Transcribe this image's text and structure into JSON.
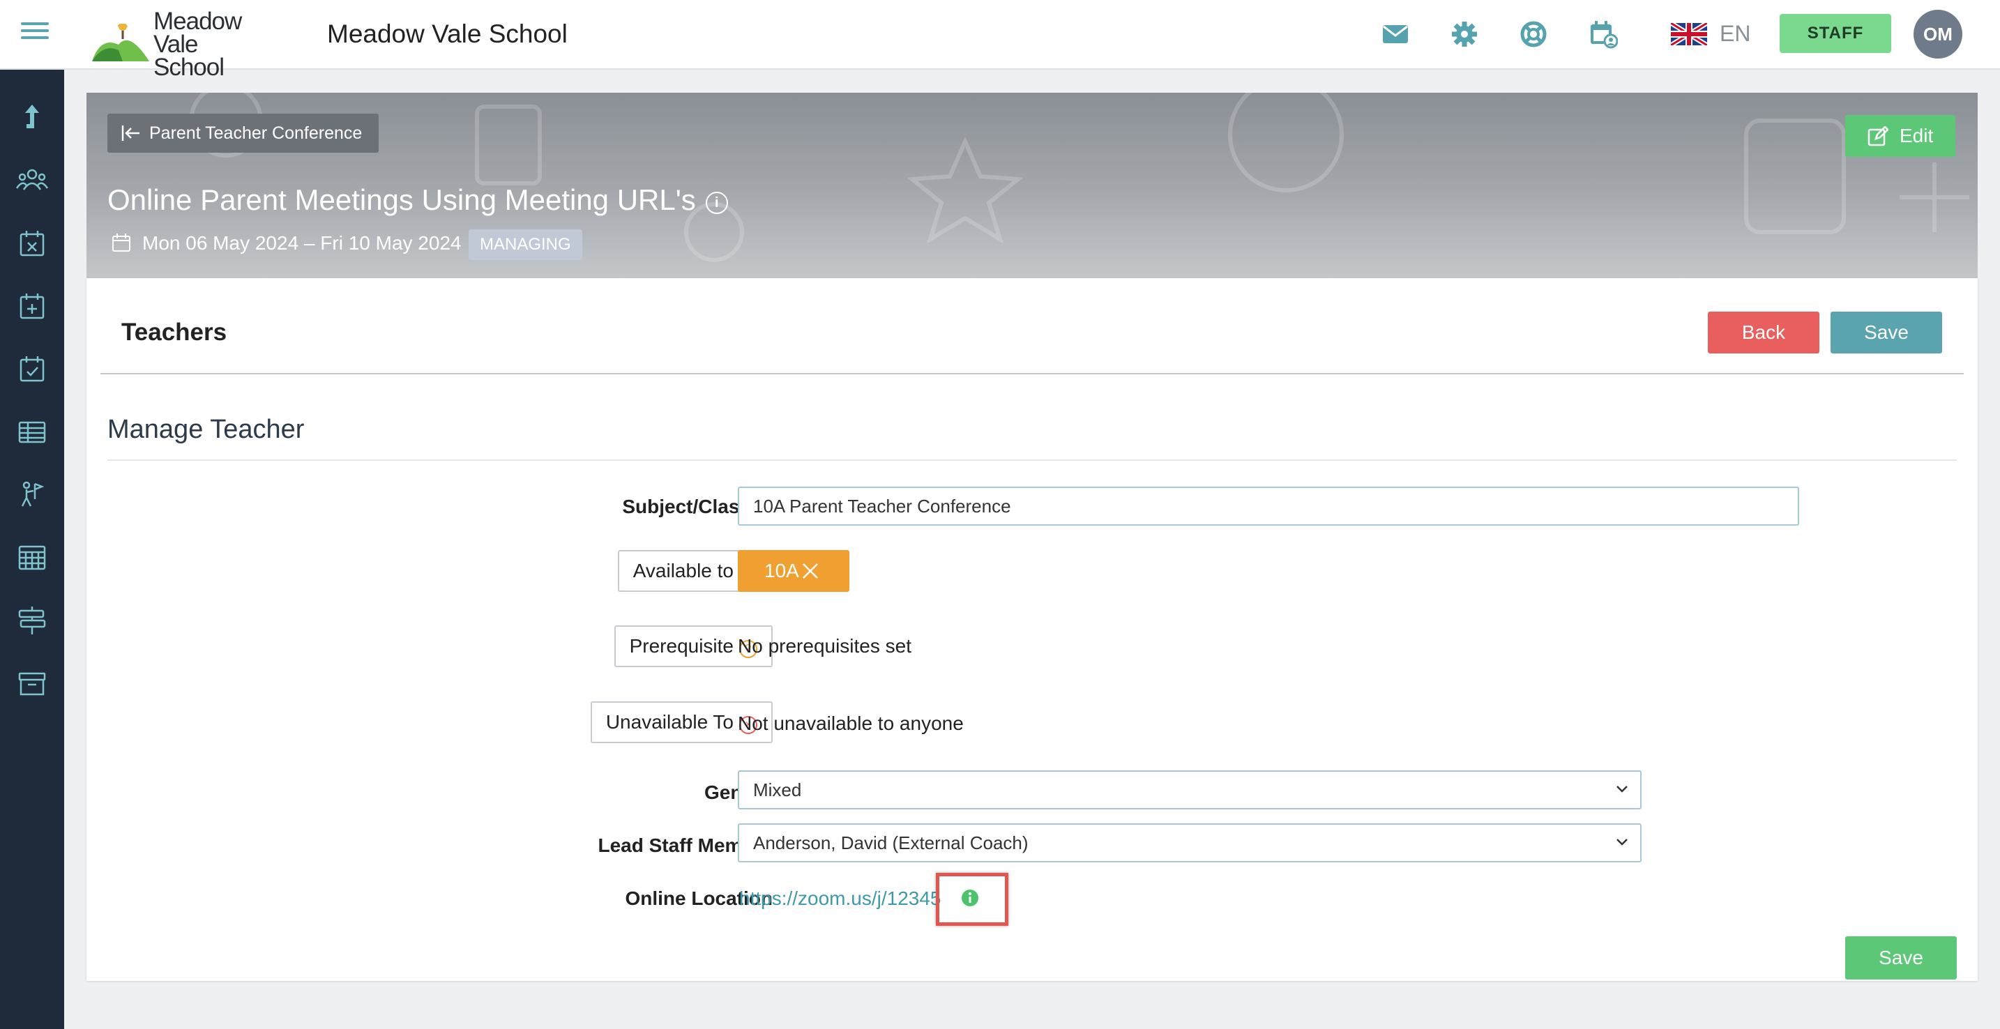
{
  "header": {
    "logo_line1": "Meadow",
    "logo_line2": "Vale School",
    "school_name": "Meadow Vale School",
    "language": "EN",
    "staff_label": "STAFF",
    "avatar_initials": "OM"
  },
  "sidebar": {
    "items": [
      {
        "icon": "arrow-up-icon"
      },
      {
        "icon": "people-icon"
      },
      {
        "icon": "calendar-x-icon"
      },
      {
        "icon": "calendar-plus-icon"
      },
      {
        "icon": "calendar-check-icon"
      },
      {
        "icon": "table-icon"
      },
      {
        "icon": "person-flag-icon"
      },
      {
        "icon": "grid-calendar-icon"
      },
      {
        "icon": "signpost-icon"
      },
      {
        "icon": "archive-icon"
      }
    ]
  },
  "banner": {
    "breadcrumb": "Parent Teacher Conference",
    "edit_label": "Edit",
    "title": "Online Parent Meetings Using Meeting URL's",
    "date_range": "Mon 06 May 2024 – Fri 10 May 2024",
    "badge": "MANAGING"
  },
  "section": {
    "heading": "Teachers",
    "back_label": "Back",
    "save_label": "Save"
  },
  "form": {
    "heading": "Manage Teacher",
    "subject_label": "Subject/Class",
    "subject_value": "10A Parent Teacher Conference",
    "available_label": "Available to",
    "available_tag": "10A",
    "prerequisite_label": "Prerequisite",
    "prerequisite_value": "No prerequisites set",
    "unavailable_label": "Unavailable To",
    "unavailable_value": "Not unavailable to anyone",
    "gender_label": "Gender",
    "gender_value": "Mixed",
    "lead_label": "Lead Staff Member",
    "lead_value": "Anderson, David (External Coach)",
    "online_label": "Online Location",
    "online_value": "https://zoom.us/j/12345",
    "save_label": "Save"
  },
  "colors": {
    "accent": "#5aa4b0",
    "sidebar": "#1f2a3a",
    "success": "#5cc777",
    "danger": "#e95f5d",
    "warning": "#f0a030"
  }
}
